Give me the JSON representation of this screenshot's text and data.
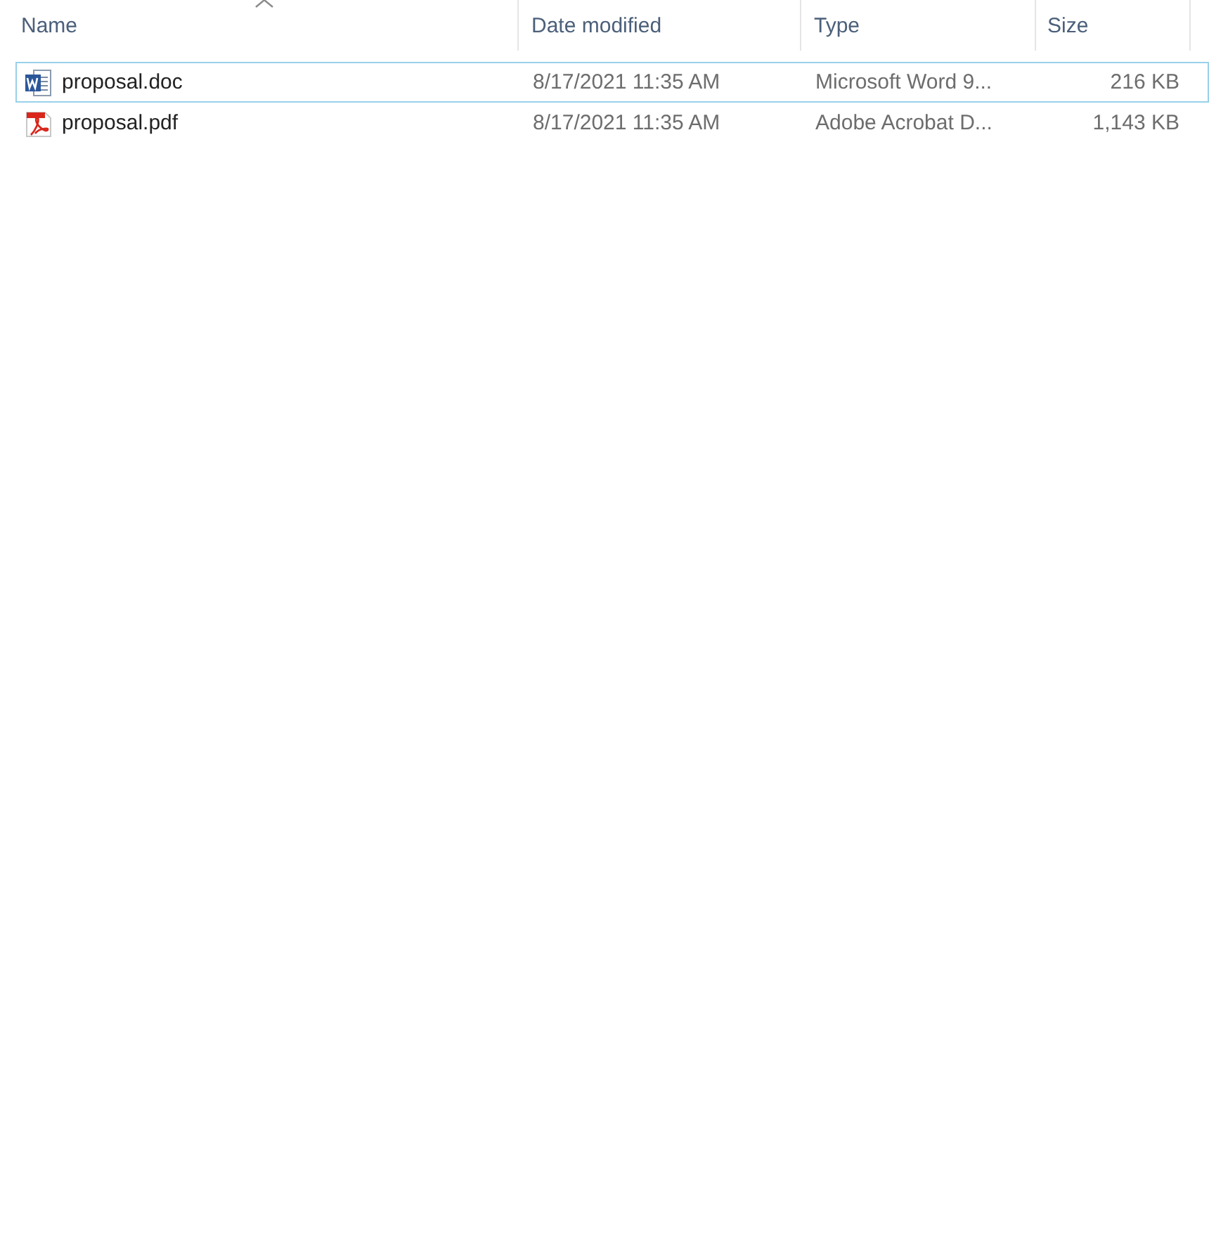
{
  "columns": [
    {
      "label": "Name",
      "sorted": true
    },
    {
      "label": "Date modified",
      "sorted": false
    },
    {
      "label": "Type",
      "sorted": false
    },
    {
      "label": "Size",
      "sorted": false
    }
  ],
  "rows": [
    {
      "kind": "word",
      "name": "proposal.doc",
      "date_modified": "8/17/2021 11:35 AM",
      "type": "Microsoft Word 9...",
      "size": "216 KB",
      "focused": true
    },
    {
      "kind": "pdf",
      "name": "proposal.pdf",
      "date_modified": "8/17/2021 11:35 AM",
      "type": "Adobe Acrobat D...",
      "size": "1,143 KB",
      "focused": false
    }
  ]
}
